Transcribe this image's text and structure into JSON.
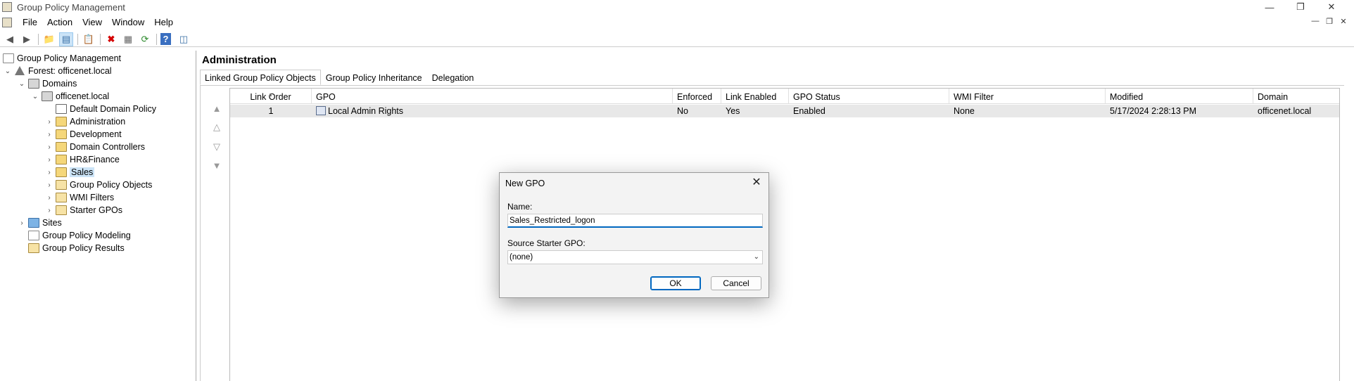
{
  "window": {
    "title": "Group Policy Management"
  },
  "menu": {
    "items": [
      "File",
      "Action",
      "View",
      "Window",
      "Help"
    ]
  },
  "tree": {
    "items": [
      {
        "label": "Group Policy Management",
        "icon": "gpm-icon",
        "expander": ""
      },
      {
        "label": "Forest: officenet.local",
        "icon": "forest-icon",
        "expander": "expanded"
      },
      {
        "label": "Domains",
        "icon": "folder-icon",
        "expander": "expanded"
      },
      {
        "label": "officenet.local",
        "icon": "domain-icon",
        "expander": "expanded"
      },
      {
        "label": "Default Domain Policy",
        "icon": "gpo-link-icon",
        "expander": ""
      },
      {
        "label": "Administration",
        "icon": "ou-icon",
        "expander": "collapsed"
      },
      {
        "label": "Development",
        "icon": "ou-icon",
        "expander": "collapsed"
      },
      {
        "label": "Domain Controllers",
        "icon": "ou-icon",
        "expander": "collapsed"
      },
      {
        "label": "HR&Finance",
        "icon": "ou-icon",
        "expander": "collapsed"
      },
      {
        "label": "Sales",
        "icon": "ou-icon",
        "expander": "collapsed"
      },
      {
        "label": "Group Policy Objects",
        "icon": "folder-icon",
        "expander": "collapsed"
      },
      {
        "label": "WMI Filters",
        "icon": "folder-icon",
        "expander": "collapsed"
      },
      {
        "label": "Starter GPOs",
        "icon": "folder-icon",
        "expander": "collapsed"
      },
      {
        "label": "Sites",
        "icon": "sites-icon",
        "expander": "collapsed"
      },
      {
        "label": "Group Policy Modeling",
        "icon": "modeling-icon",
        "expander": ""
      },
      {
        "label": "Group Policy Results",
        "icon": "results-icon",
        "expander": ""
      }
    ],
    "selected": "Sales"
  },
  "main": {
    "title": "Administration",
    "tabs": [
      "Linked Group Policy Objects",
      "Group Policy Inheritance",
      "Delegation"
    ],
    "active_tab": "Linked Group Policy Objects",
    "columns": [
      "Link Order",
      "GPO",
      "Enforced",
      "Link Enabled",
      "GPO Status",
      "WMI Filter",
      "Modified",
      "Domain"
    ],
    "rows": [
      [
        "1",
        "Local Admin Rights",
        "No",
        "Yes",
        "Enabled",
        "None",
        "5/17/2024 2:28:13 PM",
        "officenet.local"
      ]
    ]
  },
  "dialog": {
    "title": "New GPO",
    "name_label": "Name:",
    "name_value": "Sales_Restricted_logon",
    "starter_label": "Source Starter GPO:",
    "starter_value": "(none)",
    "ok_label": "OK",
    "cancel_label": "Cancel"
  },
  "colors": {
    "accent": "#0067c0",
    "selection": "#cce4f7",
    "row_highlight": "#e8e8e8"
  }
}
